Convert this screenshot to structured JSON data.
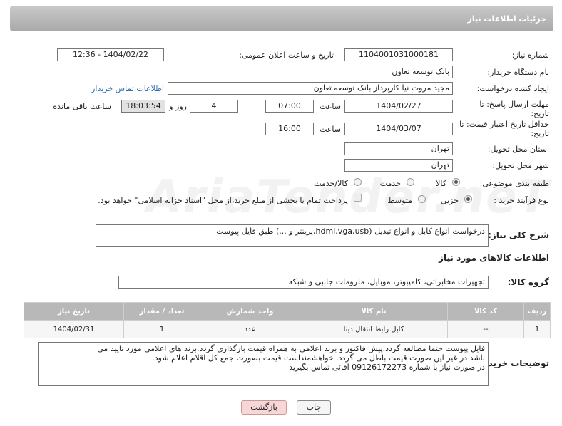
{
  "header": {
    "title": "جزئیات اطلاعات نیاز"
  },
  "fields": {
    "need_number_label": "شماره نیاز:",
    "need_number": "1104001031000181",
    "announce_label": "تاریخ و ساعت اعلان عمومی:",
    "announce_value": "1404/02/22 - 12:36",
    "buyer_org_label": "نام دستگاه خریدار:",
    "buyer_org": "بانک توسعه تعاون",
    "creator_label": "ایجاد کننده درخواست:",
    "creator": "مجید مروت نیا کارپرداز بانک توسعه تعاون",
    "contact_link": "اطلاعات تماس خریدار",
    "reply_deadline_label": "مهلت ارسال پاسخ: تا تاریخ:",
    "reply_date": "1404/02/27",
    "time_label": "ساعت",
    "reply_time": "07:00",
    "days_value": "4",
    "days_label": "روز و",
    "remaining_time": "18:03:54",
    "remaining_label": "ساعت باقی مانده",
    "price_deadline_label": "حداقل تاریخ اعتبار قیمت: تا تاریخ:",
    "price_date": "1404/03/07",
    "price_time": "16:00",
    "province_label": "استان محل تحویل:",
    "province": "تهران",
    "city_label": "شهر محل تحویل:",
    "city": "تهران",
    "category_label": "طبقه بندی موضوعی:",
    "cat_goods": "کالا",
    "cat_service": "خدمت",
    "cat_both": "کالا/خدمت",
    "process_label": "نوع فرآیند خرید :",
    "proc_partial": "جزیی",
    "proc_medium": "متوسط",
    "payment_note": "پرداخت تمام یا بخشی از مبلغ خرید،از محل \"اسناد خزانه اسلامی\" خواهد بود.",
    "summary_label": "شرح کلی نیاز:",
    "summary": "درخواست انواع کابل و انواع تبدیل (hdmi،vga،usb،پرینتر و ...) طبق فایل پیوست"
  },
  "goods": {
    "section_title": "اطلاعات کالاهای مورد نیاز",
    "group_label": "گروه کالا:",
    "group_value": "تجهیزات مخابراتی، کامپیوتر، موبایل، ملزومات جانبی و شبکه",
    "headers": [
      "ردیف",
      "کد کالا",
      "نام کالا",
      "واحد شمارش",
      "تعداد / مقدار",
      "تاریخ نیاز"
    ],
    "rows": [
      [
        "1",
        "--",
        "کابل رابط انتقال دیتا",
        "عدد",
        "1",
        "1404/02/31"
      ]
    ]
  },
  "buyer_notes": {
    "label": "توضیحات خریدار:",
    "line1": "فایل پیوست حتما مطالعه گردد.پیش فاکتور و برند اعلامی به همراه قیمت بارگذاری گردد.برند های اعلامی مورد تایید می",
    "line2": "باشد در غیر این صورت قیمت باطل می گردد. خواهشمنداست قیمت بصورت جمع کل اقلام اعلام شود.",
    "line3": "در صورت نیاز با شماره 09126172273 آقائی تماس بگیرید"
  },
  "buttons": {
    "print": "چاپ",
    "back": "بازگشت"
  },
  "watermark": "AriaTender.neT",
  "colors": {
    "header_bg": "#b3b3b3",
    "link": "#2b6cb0",
    "back_button": "#f6d6d6"
  }
}
